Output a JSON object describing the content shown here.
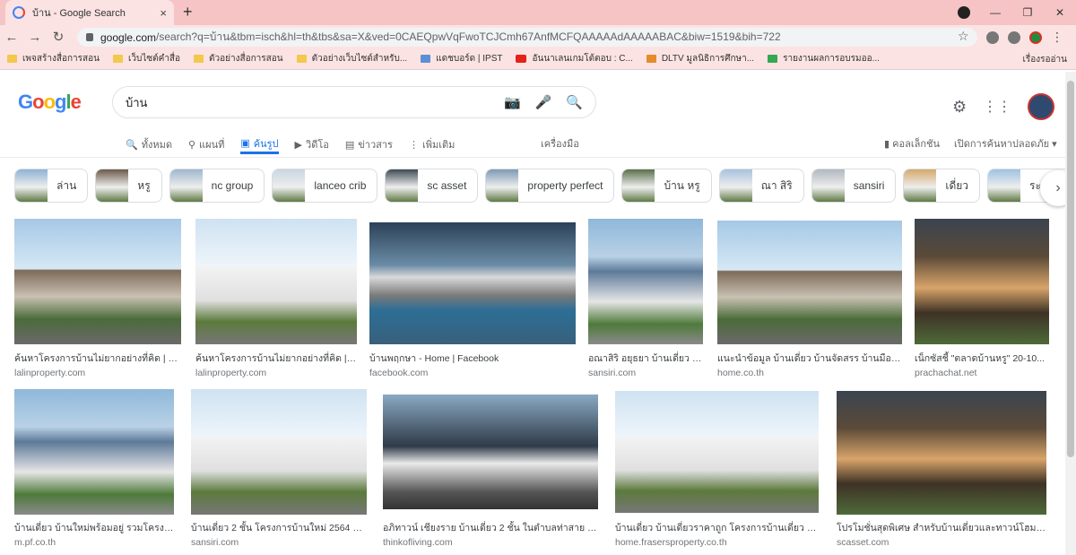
{
  "browser": {
    "tab_title": "บ้าน - Google Search",
    "tab_close": "×",
    "new_tab": "+",
    "win_min": "—",
    "win_max": "❐",
    "win_close": "✕",
    "back": "←",
    "forward": "→",
    "reload": "↻",
    "url_host": "google.com",
    "url_path": "/search?q=บ้าน&tbm=isch&hl=th&tbs&sa=X&ved=0CAEQpwVqFwoTCJCmh67AnfMCFQAAAAAdAAAAABAC&biw=1519&bih=722",
    "star": "☆",
    "menu_dots": "⋮"
  },
  "bookmarks": [
    {
      "label": "เพจสร้างสื่อการสอน",
      "icon": "folder"
    },
    {
      "label": "เว็บไซต์คำสื่อ",
      "icon": "folder"
    },
    {
      "label": "ตัวอย่างสื่อการสอน",
      "icon": "folder"
    },
    {
      "label": "ตัวอย่างเว็บไซต์สำหรับ...",
      "icon": "folder"
    },
    {
      "label": "แดชบอร์ด | IPST",
      "icon": "globe"
    },
    {
      "label": "อันนาเลนเกมโต้ตอบ : C...",
      "icon": "youtube"
    },
    {
      "label": "DLTV มูลนิธิการศึกษา...",
      "icon": "dltv"
    },
    {
      "label": "รายงานผลการอบรมออ...",
      "icon": "book"
    }
  ],
  "bookmarks_right": "เรื่องรออ่าน",
  "google": {
    "logo": "Google",
    "query": "บ้าน"
  },
  "menu": [
    {
      "label": "ทั้งหมด",
      "icon": "🔍",
      "active": false
    },
    {
      "label": "แผนที่",
      "icon": "⚲",
      "active": false
    },
    {
      "label": "ค้นรูป",
      "icon": "▣",
      "active": true
    },
    {
      "label": "วิดีโอ",
      "icon": "▶",
      "active": false
    },
    {
      "label": "ข่าวสาร",
      "icon": "▤",
      "active": false
    },
    {
      "label": "เพิ่มเติม",
      "icon": "⋮",
      "active": false
    }
  ],
  "tools": "เครื่องมือ",
  "collections": "คอลเล็กชัน",
  "safesearch": "เปิดการค้นหาปลอดภัย ▾",
  "chips": [
    "ล่าน",
    "หรู",
    "nc group",
    "lanceo crib",
    "sc asset",
    "property perfect",
    "บ้าน หรู",
    "ณา สิริ",
    "sansiri",
    "เดี่ยว",
    "ระยอง"
  ],
  "results_row1": [
    {
      "caption": "ค้นหาโครงการบ้านไม่ยากอย่างที่คิด | คลิ...",
      "source": "lalinproperty.com",
      "style": "a"
    },
    {
      "caption": "ค้นหาโครงการบ้านไม่ยากอย่างที่คิด | ค...",
      "source": "lalinproperty.com",
      "style": "b"
    },
    {
      "caption": "บ้านพฤกษา - Home | Facebook",
      "source": "facebook.com",
      "style": "c"
    },
    {
      "caption": "อณาสิริ อยุธยา บ้านเดี่ยว ท...",
      "source": "sansiri.com",
      "style": "d"
    },
    {
      "caption": "แนะนำข้อมูล บ้านเดี่ยว บ้านจัดสรร บ้านมือสอ...",
      "source": "home.co.th",
      "style": "a"
    },
    {
      "caption": "เน็กซัสชี้ \"ตลาดบ้านหรู\" 20-10...",
      "source": "prachachat.net",
      "style": "e"
    }
  ],
  "results_row2": [
    {
      "caption": "บ้านเดี่ยว บ้านใหม่พร้อมอยู่ รวมโครงกา...",
      "source": "m.pf.co.th",
      "style": "d"
    },
    {
      "caption": "บ้านเดี่ยว 2 ชั้น โครงการบ้านใหม่ 2564 พร้อ...",
      "source": "sansiri.com",
      "style": "b"
    },
    {
      "caption": "อภิทาวน์ เชียงราย บ้านเดี่ยว 2 ชั้น ในตำบลท่าสาย ติด...",
      "source": "thinkofliving.com",
      "style": "f"
    },
    {
      "caption": "บ้านเดี่ยว บ้านเดี่ยวราคาถูก โครงการบ้านเดี่ยว ทำเ...",
      "source": "home.frasersproperty.co.th",
      "style": "b"
    },
    {
      "caption": "โปรโมชั่นสุดพิเศษ สำหรับบ้านเดี่ยวและทาวน์โฮม | S...",
      "source": "scasset.com",
      "style": "e"
    }
  ]
}
